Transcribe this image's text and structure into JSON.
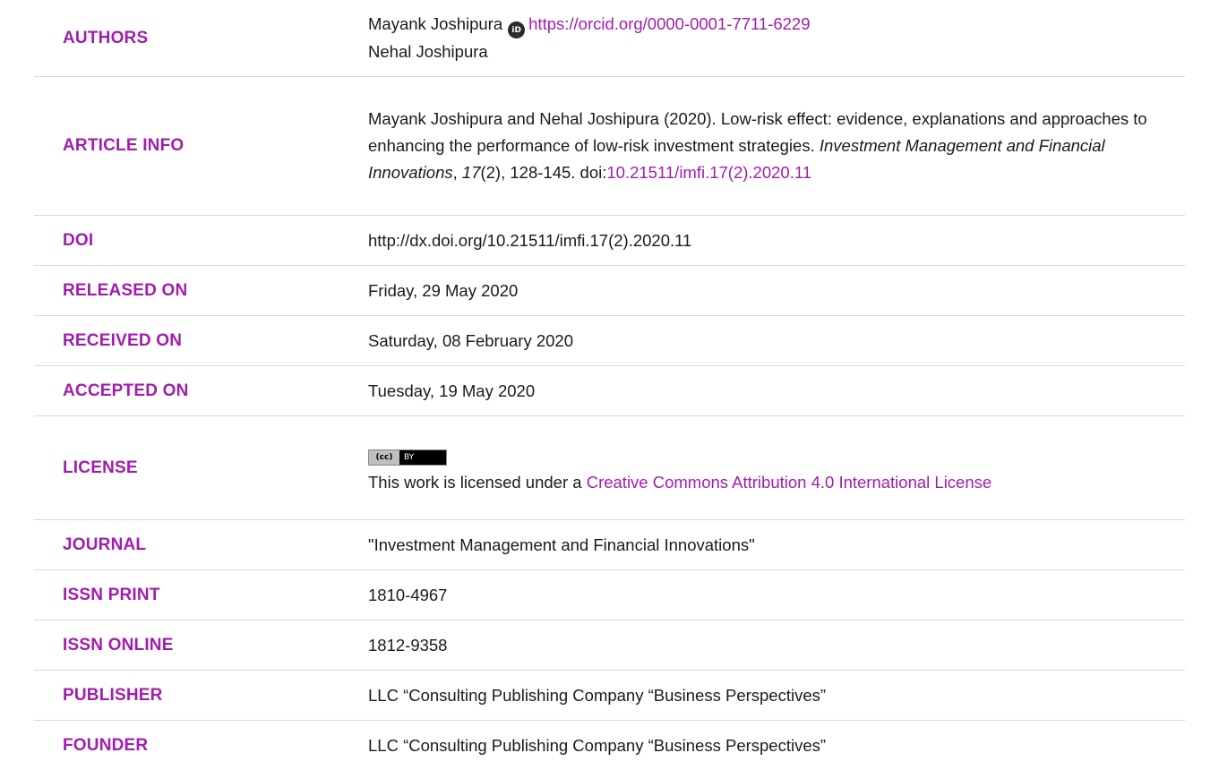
{
  "rows": {
    "authors": {
      "label": "AUTHORS",
      "author1": "Mayank Joshipura",
      "orcid_icon_text": "iD",
      "orcid_url": "https://orcid.org/0000-0001-7711-6229",
      "author2": "Nehal Joshipura"
    },
    "article_info": {
      "label": "ARTICLE INFO",
      "citation_prefix": "Mayank Joshipura and Nehal Joshipura (2020). Low-risk effect: evidence, explanations and approaches to enhancing the performance of low-risk investment strategies. ",
      "journal_italic": "Investment Management and Financial Innovations",
      "sep1": ", ",
      "volume_italic": "17",
      "issue": "(2), 128-145. doi:",
      "doi_link": "10.21511/imfi.17(2).2020.11"
    },
    "doi": {
      "label": "DOI",
      "value": "http://dx.doi.org/10.21511/imfi.17(2).2020.11"
    },
    "released_on": {
      "label": "RELEASED ON",
      "value": "Friday, 29 May 2020"
    },
    "received_on": {
      "label": "RECEIVED ON",
      "value": "Saturday, 08 February 2020"
    },
    "accepted_on": {
      "label": "ACCEPTED ON",
      "value": "Tuesday, 19 May 2020"
    },
    "license": {
      "label": "LICENSE",
      "badge_cc": "(cc)",
      "badge_by": "BY",
      "text_prefix": "This work is licensed under a ",
      "link": "Creative Commons Attribution 4.0 International License"
    },
    "journal": {
      "label": "JOURNAL",
      "value": "\"Investment Management and Financial Innovations\""
    },
    "issn_print": {
      "label": "ISSN PRINT",
      "value": "1810-4967"
    },
    "issn_online": {
      "label": "ISSN ONLINE",
      "value": "1812-9358"
    },
    "publisher": {
      "label": "PUBLISHER",
      "value": "LLC “Consulting Publishing Company “Business Perspectives”"
    },
    "founder": {
      "label": "FOUNDER",
      "value": "LLC “Consulting Publishing Company “Business Perspectives”"
    }
  },
  "colors": {
    "label": "#a21caf",
    "text": "#1a1a1a",
    "divider": "#d9d9d9"
  }
}
